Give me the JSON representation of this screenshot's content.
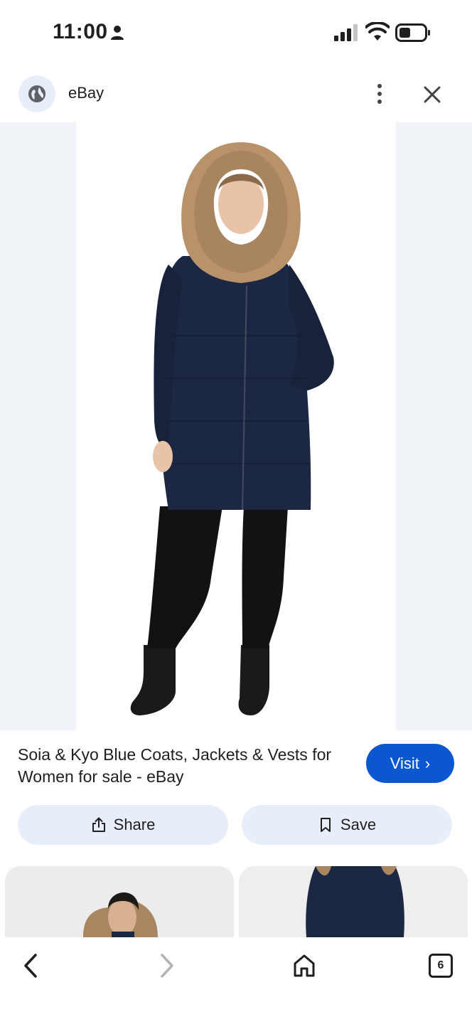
{
  "status_bar": {
    "time": "11:00"
  },
  "header": {
    "site_name": "eBay"
  },
  "result": {
    "title": "Soia & Kyo Blue Coats, Jackets & Vests for Women for sale - eBay",
    "visit_label": "Visit"
  },
  "actions": {
    "share_label": "Share",
    "save_label": "Save"
  },
  "nav": {
    "tab_count": "6"
  },
  "colors": {
    "accent": "#0b57d0",
    "pill_bg": "#e8eef9",
    "coat": "#1c2744"
  }
}
